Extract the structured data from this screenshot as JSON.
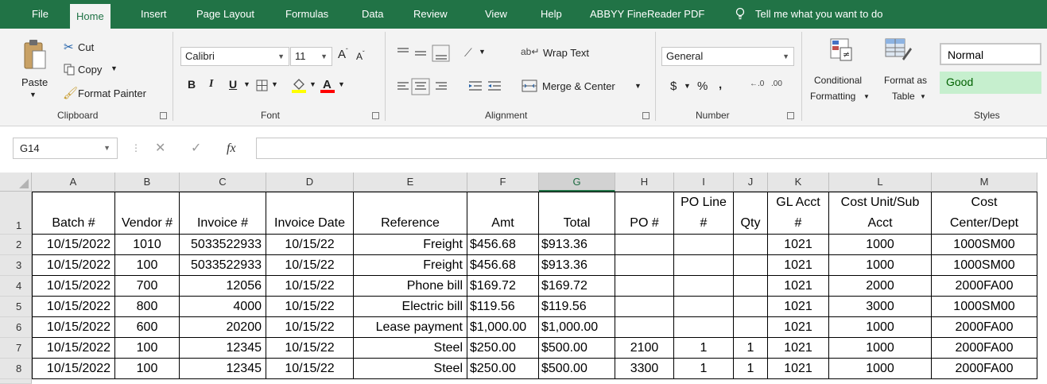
{
  "menu": {
    "tabs": [
      "File",
      "Home",
      "Insert",
      "Page Layout",
      "Formulas",
      "Data",
      "Review",
      "View",
      "Help",
      "ABBYY FineReader PDF"
    ],
    "tell_me": "Tell me what you want to do"
  },
  "ribbon": {
    "clipboard": {
      "paste": "Paste",
      "cut": "Cut",
      "copy": "Copy",
      "format_painter": "Format Painter",
      "label": "Clipboard"
    },
    "font": {
      "name": "Calibri",
      "size": "11",
      "bold": "B",
      "italic": "I",
      "underline": "U",
      "label": "Font",
      "fill_color": "#ffff00",
      "font_color": "#ff0000"
    },
    "alignment": {
      "wrap_text": "Wrap Text",
      "merge_center": "Merge & Center",
      "label": "Alignment"
    },
    "number": {
      "format": "General",
      "currency": "$",
      "percent": "%",
      "comma": ",",
      "label": "Number"
    },
    "styles": {
      "conditional_line1": "Conditional",
      "conditional_line2": "Formatting",
      "format_as_line1": "Format as",
      "format_as_line2": "Table",
      "normal": "Normal",
      "good": "Good",
      "label": "Styles",
      "good_bg": "#c6efce",
      "good_fg": "#006100"
    }
  },
  "formula_bar": {
    "name_box": "G14",
    "fx": "fx",
    "value": ""
  },
  "sheet": {
    "columns": [
      "A",
      "B",
      "C",
      "D",
      "E",
      "F",
      "G",
      "H",
      "I",
      "J",
      "K",
      "L",
      "M"
    ],
    "selected_column": "G",
    "headers": [
      [
        "",
        "Batch #"
      ],
      [
        "",
        "Vendor #"
      ],
      [
        "",
        "Invoice #"
      ],
      [
        "",
        "Invoice Date"
      ],
      [
        "",
        "Reference"
      ],
      [
        "",
        "Amt"
      ],
      [
        "",
        "Total"
      ],
      [
        "",
        "PO #"
      ],
      [
        "PO Line",
        "#"
      ],
      [
        "",
        "Qty"
      ],
      [
        "GL Acct",
        "#"
      ],
      [
        "Cost Unit/Sub",
        "Acct"
      ],
      [
        "Cost",
        "Center/Dept"
      ]
    ],
    "rows": [
      [
        "10/15/2022",
        "1010",
        "5033522933",
        "10/15/22",
        "Freight",
        "$456.68",
        "$913.36",
        "",
        "",
        "",
        "1021",
        "1000",
        "1000SM00"
      ],
      [
        "10/15/2022",
        "100",
        "5033522933",
        "10/15/22",
        "Freight",
        "$456.68",
        "$913.36",
        "",
        "",
        "",
        "1021",
        "1000",
        "1000SM00"
      ],
      [
        "10/15/2022",
        "700",
        "12056",
        "10/15/22",
        "Phone bill",
        "$169.72",
        "$169.72",
        "",
        "",
        "",
        "1021",
        "2000",
        "2000FA00"
      ],
      [
        "10/15/2022",
        "800",
        "4000",
        "10/15/22",
        "Electric bill",
        "$119.56",
        "$119.56",
        "",
        "",
        "",
        "1021",
        "3000",
        "1000SM00"
      ],
      [
        "10/15/2022",
        "600",
        "20200",
        "10/15/22",
        "Lease payment",
        "$1,000.00",
        "$1,000.00",
        "",
        "",
        "",
        "1021",
        "1000",
        "2000FA00"
      ],
      [
        "10/15/2022",
        "100",
        "12345",
        "10/15/22",
        "Steel",
        "$250.00",
        "$500.00",
        "2100",
        "1",
        "1",
        "1021",
        "1000",
        "2000FA00"
      ],
      [
        "10/15/2022",
        "100",
        "12345",
        "10/15/22",
        "Steel",
        "$250.00",
        "$500.00",
        "3300",
        "1",
        "1",
        "1021",
        "1000",
        "2000FA00"
      ]
    ],
    "row_numbers": [
      "1",
      "2",
      "3",
      "4",
      "5",
      "6",
      "7",
      "8"
    ]
  }
}
